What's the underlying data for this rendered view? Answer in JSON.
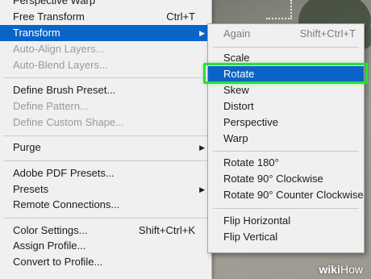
{
  "main_menu": {
    "items": [
      {
        "label": "Perspective Warp",
        "shortcut": "",
        "submenu": false,
        "disabled": false,
        "active": false
      },
      {
        "label": "Free Transform",
        "shortcut": "Ctrl+T",
        "submenu": false,
        "disabled": false,
        "active": false
      },
      {
        "label": "Transform",
        "shortcut": "",
        "submenu": true,
        "disabled": false,
        "active": true
      },
      {
        "label": "Auto-Align Layers...",
        "shortcut": "",
        "submenu": false,
        "disabled": true,
        "active": false
      },
      {
        "label": "Auto-Blend Layers...",
        "shortcut": "",
        "submenu": false,
        "disabled": true,
        "active": false
      },
      {
        "label": "Define Brush Preset...",
        "shortcut": "",
        "submenu": false,
        "disabled": false,
        "active": false
      },
      {
        "label": "Define Pattern...",
        "shortcut": "",
        "submenu": false,
        "disabled": true,
        "active": false
      },
      {
        "label": "Define Custom Shape...",
        "shortcut": "",
        "submenu": false,
        "disabled": true,
        "active": false
      },
      {
        "label": "Purge",
        "shortcut": "",
        "submenu": true,
        "disabled": false,
        "active": false
      },
      {
        "label": "Adobe PDF Presets...",
        "shortcut": "",
        "submenu": false,
        "disabled": false,
        "active": false
      },
      {
        "label": "Presets",
        "shortcut": "",
        "submenu": true,
        "disabled": false,
        "active": false
      },
      {
        "label": "Remote Connections...",
        "shortcut": "",
        "submenu": false,
        "disabled": false,
        "active": false
      },
      {
        "label": "Color Settings...",
        "shortcut": "Shift+Ctrl+K",
        "submenu": false,
        "disabled": false,
        "active": false
      },
      {
        "label": "Assign Profile...",
        "shortcut": "",
        "submenu": false,
        "disabled": false,
        "active": false
      },
      {
        "label": "Convert to Profile...",
        "shortcut": "",
        "submenu": false,
        "disabled": false,
        "active": false
      }
    ]
  },
  "transform_submenu": {
    "items": [
      {
        "label": "Again",
        "shortcut": "Shift+Ctrl+T",
        "disabled": true,
        "active": false
      },
      {
        "label": "Scale",
        "shortcut": "",
        "disabled": false,
        "active": false
      },
      {
        "label": "Rotate",
        "shortcut": "",
        "disabled": false,
        "active": true
      },
      {
        "label": "Skew",
        "shortcut": "",
        "disabled": false,
        "active": false
      },
      {
        "label": "Distort",
        "shortcut": "",
        "disabled": false,
        "active": false
      },
      {
        "label": "Perspective",
        "shortcut": "",
        "disabled": false,
        "active": false
      },
      {
        "label": "Warp",
        "shortcut": "",
        "disabled": false,
        "active": false
      },
      {
        "label": "Rotate 180°",
        "shortcut": "",
        "disabled": false,
        "active": false
      },
      {
        "label": "Rotate 90° Clockwise",
        "shortcut": "",
        "disabled": false,
        "active": false
      },
      {
        "label": "Rotate 90° Counter Clockwise",
        "shortcut": "",
        "disabled": false,
        "active": false
      },
      {
        "label": "Flip Horizontal",
        "shortcut": "",
        "disabled": false,
        "active": false
      },
      {
        "label": "Flip Vertical",
        "shortcut": "",
        "disabled": false,
        "active": false
      }
    ]
  },
  "colors": {
    "menu_bg": "#f0f0f0",
    "highlight": "#0a64c8",
    "disabled_text": "#9a9a9a",
    "callout_outline": "#29e035"
  },
  "icons": {
    "submenu_arrow": "submenu-arrow-icon"
  },
  "watermark": {
    "prefix": "wiki",
    "suffix": "How"
  }
}
